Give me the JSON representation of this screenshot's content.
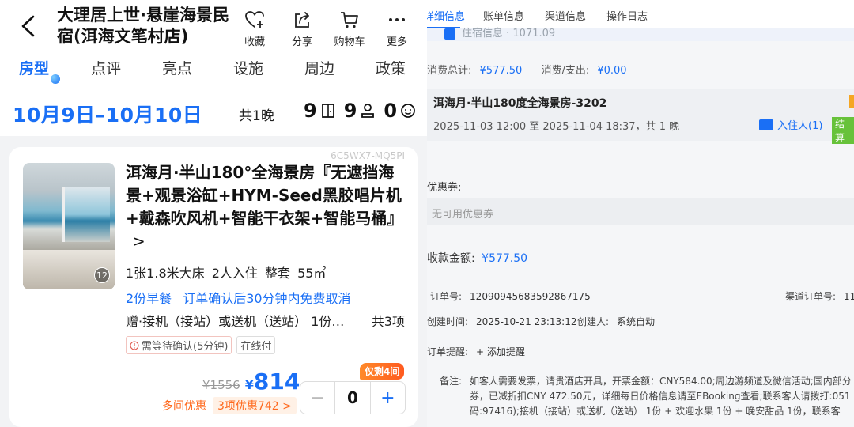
{
  "left": {
    "header": {
      "back_label": "<",
      "hotel_name": "大理居上世·悬崖海景民宿(洱海文笔村店)",
      "actions": [
        {
          "icon": "heart-plus-icon",
          "label": "收藏"
        },
        {
          "icon": "share-icon",
          "label": "分享"
        },
        {
          "icon": "cart-icon",
          "label": "购物车"
        },
        {
          "icon": "more-icon",
          "label": "更多"
        }
      ]
    },
    "tabs": [
      "房型",
      "点评",
      "亮点",
      "设施",
      "周边",
      "政策"
    ],
    "active_tab": "房型",
    "dates": "10月9日–10月10日",
    "nights": "共1晚",
    "guests": [
      {
        "icon": "room-door-icon",
        "value": "9"
      },
      {
        "icon": "adult-icon",
        "value": "9"
      },
      {
        "icon": "child-icon",
        "value": "0"
      }
    ],
    "card": {
      "code": "6C5WX7-MQ5PI",
      "image_count": "12",
      "room_name": "洱海月·半山180°全海景房『无遮挡海景+观景浴缸+HYM-Seed黑胶唱片机+戴森吹风机+智能干衣架+智能马桶』",
      "chevron": ">",
      "specs": "1张1.8米大床 2人入住 整套 55㎡",
      "policy": [
        "2份早餐",
        "订单确认后30分钟内免费取消"
      ],
      "gift": "赠·接机（接站）或送机（送站） 1份…",
      "gift_total": "共3项",
      "tags": [
        "需等待确认(5分钟)",
        "在线付"
      ],
      "remaining": "仅剩4间",
      "old_price": "¥1556",
      "currency": "¥",
      "price": "814",
      "discount_label": "多间优惠",
      "discount_button": "3项优惠742 >",
      "stepper": {
        "minus": "−",
        "qty": "0",
        "plus": "+"
      }
    }
  },
  "right": {
    "tabs": [
      "详细信息",
      "账单信息",
      "渠道信息",
      "操作日志"
    ],
    "active_tab": "详细信息",
    "clipped_header": "住宿信息 · 1071.09",
    "money": {
      "total_label": "消费总计:",
      "total": "¥577.50",
      "spend_label": "消费/支出:",
      "spend": "¥0.00"
    },
    "room": {
      "title": "洱海月·半山180度全海景房-3202",
      "date": "2025-11-03 12:00 至 2025-11-04 18:37，共 1 晚",
      "guests_link": "入住人(1)",
      "status": "结算"
    },
    "coupon": {
      "label": "优惠券:",
      "placeholder": "无可用优惠券"
    },
    "payment": {
      "label": "收款金额:",
      "value": "¥577.50"
    },
    "order_no": {
      "label": "订单号:",
      "value": "12090945683592867175"
    },
    "channel_no": {
      "label": "渠道订单号:",
      "value": "11"
    },
    "created_time": {
      "label": "创建时间:",
      "value": "2025-10-21 23:13:12"
    },
    "creator": {
      "label": "创建人:",
      "value": "系统自动"
    },
    "reminder": {
      "label": "订单提醒:",
      "action": "+ 添加提醒"
    },
    "remark": {
      "label": "备注:",
      "text": "如客人需要发票，请贵酒店开具，开票金额：CNY584.00;周边游频道及微信活动;国内部分券，已减折扣CNY 472.50元，详细每日价格信息请至EBooking查看;联系客人请拨打:051码:97416);接机（接站）或送机（送站） 1份 + 欢迎水果 1份 + 晚安甜品 1份，联系客"
    }
  },
  "colors": {
    "accent": "#1a6ff5",
    "orange": "#ff6a1f",
    "green": "#67c23a"
  }
}
